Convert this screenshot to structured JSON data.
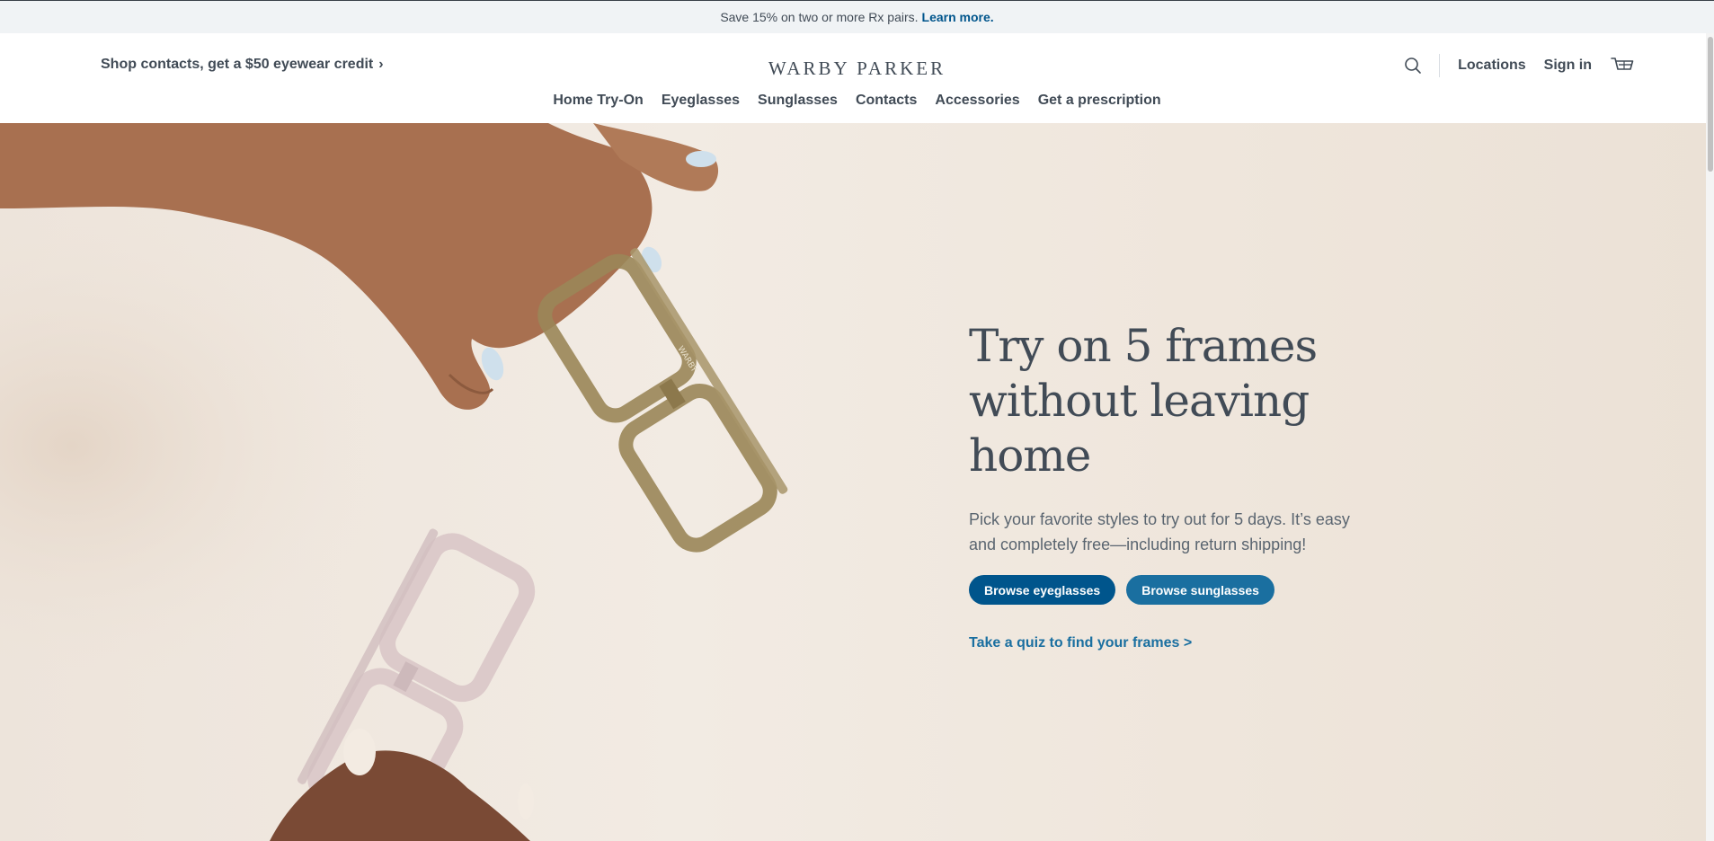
{
  "promo": {
    "text": "Save 15% on two or more Rx pairs.",
    "link": "Learn more."
  },
  "header": {
    "credit_link": "Shop contacts, get a $50 eyewear credit",
    "credit_chevron": "›",
    "logo": "WARBY PARKER",
    "locations": "Locations",
    "sign_in": "Sign in",
    "search_icon": "search-icon",
    "cart_icon": "cart-icon"
  },
  "nav": {
    "items": [
      "Home Try-On",
      "Eyeglasses",
      "Sunglasses",
      "Contacts",
      "Accessories",
      "Get a prescription"
    ]
  },
  "hero": {
    "title_line1": "Try on 5 frames",
    "title_line2": "without leaving",
    "title_line3": "home",
    "subtitle": "Pick your favorite styles to try out for 5 days. It’s easy and completely free—including return shipping!",
    "cta_primary": "Browse eyeglasses",
    "cta_secondary": "Browse sunglasses",
    "quiz_link": "Take a quiz to find your frames >",
    "frame_engraving": "WARBY"
  },
  "colors": {
    "brand_blue": "#00558c",
    "text": "#414b56",
    "hero_bg": "#efe6dc",
    "promo_bg": "#f0f3f5"
  }
}
